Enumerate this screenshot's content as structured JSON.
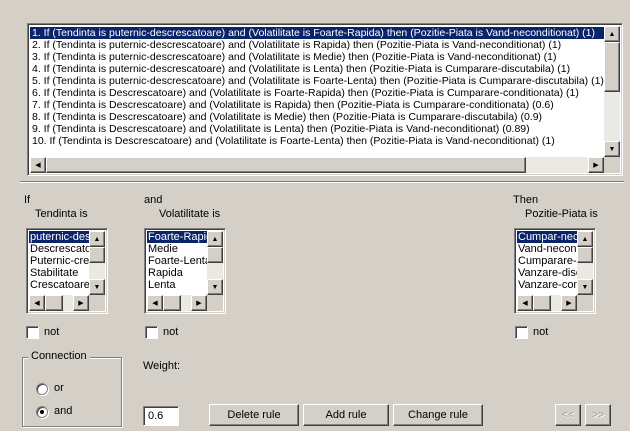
{
  "rules": [
    "1. If (Tendinta is puternic-descrescatoare) and (Volatilitate is Foarte-Rapida) then (Pozitie-Piata is Vand-neconditionat) (1)",
    "2. If (Tendinta is puternic-descrescatoare) and (Volatilitate is Rapida) then (Pozitie-Piata is Vand-neconditionat) (1)",
    "3. If (Tendinta is puternic-descrescatoare) and (Volatilitate is Medie) then (Pozitie-Piata is Vand-neconditionat) (1)",
    "4. If (Tendinta is puternic-descrescatoare) and (Volatilitate is Lenta) then (Pozitie-Piata is Cumparare-discutabila) (1)",
    "5. If (Tendinta is puternic-descrescatoare) and (Volatilitate is Foarte-Lenta) then (Pozitie-Piata is Cumparare-discutabila) (1)",
    "6. If (Tendinta is Descrescatoare) and (Volatilitate is Foarte-Rapida) then (Pozitie-Piata is Cumparare-conditionata) (1)",
    "7. If (Tendinta is Descrescatoare) and (Volatilitate is Rapida) then (Pozitie-Piata is Cumparare-conditionata) (0.6)",
    "8. If (Tendinta is Descrescatoare) and (Volatilitate is Medie) then (Pozitie-Piata is Cumparare-discutabila) (0.9)",
    "9. If (Tendinta is Descrescatoare) and (Volatilitate is Lenta) then (Pozitie-Piata is Vand-neconditionat) (0.89)",
    "10. If (Tendinta is Descrescatoare) and (Volatilitate is Foarte-Lenta) then (Pozitie-Piata is Vand-neconditionat) (1)"
  ],
  "if_label": "If",
  "and_label": "and",
  "then_label": "Then",
  "input1": {
    "title": "Tendinta is",
    "items": [
      "puternic-desc",
      "Descrescatoa",
      "Puternic-cresc",
      "Stabilitate",
      "Crescatoare"
    ],
    "not_label": "not"
  },
  "input2": {
    "title": "Volatilitate is",
    "items": [
      "Foarte-Rapida",
      "Medie",
      "Foarte-Lenta",
      "Rapida",
      "Lenta"
    ],
    "not_label": "not"
  },
  "output": {
    "title": "Pozitie-Piata is",
    "items": [
      "Cumpar-necor",
      "Vand-necondi",
      "Cumparare-dis",
      "Vanzare-discu",
      "Vanzare-cond"
    ],
    "not_label": "not"
  },
  "connection": {
    "title": "Connection",
    "or_label": "or",
    "and_label": "and",
    "selected": "and"
  },
  "weight": {
    "label": "Weight:",
    "value": "0.6"
  },
  "buttons": {
    "delete": "Delete rule",
    "add": "Add rule",
    "change": "Change rule",
    "prev": "<<",
    "next": ">>"
  }
}
